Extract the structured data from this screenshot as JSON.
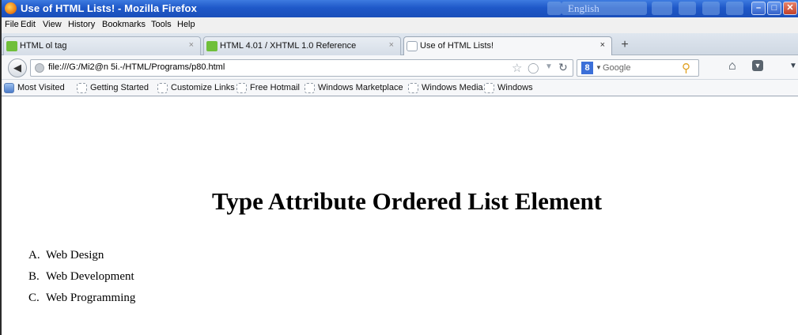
{
  "window": {
    "title": "Use of HTML Lists! - Mozilla Firefox",
    "language": "English"
  },
  "menu": [
    "File",
    "Edit",
    "View",
    "History",
    "Bookmarks",
    "Tools",
    "Help"
  ],
  "tabs": [
    {
      "label": "HTML ol tag",
      "close": "×"
    },
    {
      "label": "HTML 4.01 / XHTML 1.0 Reference",
      "close": "×"
    },
    {
      "label": "Use of HTML Lists!",
      "close": "×",
      "active": true
    }
  ],
  "new_tab": "+",
  "nav": {
    "url": "file:///G:/Mi2@n 5i.-/HTML/Programs/p80.html",
    "search_engine": "8",
    "search_placeholder": "Google"
  },
  "bookmarks": [
    "Most Visited",
    "Getting Started",
    "Customize Links",
    "Free Hotmail",
    "Windows Marketplace",
    "Windows Media",
    "Windows"
  ],
  "page": {
    "heading": "Type Attribute Ordered List Element",
    "list": [
      {
        "marker": "A.",
        "text": "Web Design"
      },
      {
        "marker": "B.",
        "text": "Web Development"
      },
      {
        "marker": "C.",
        "text": "Web Programming"
      }
    ]
  }
}
